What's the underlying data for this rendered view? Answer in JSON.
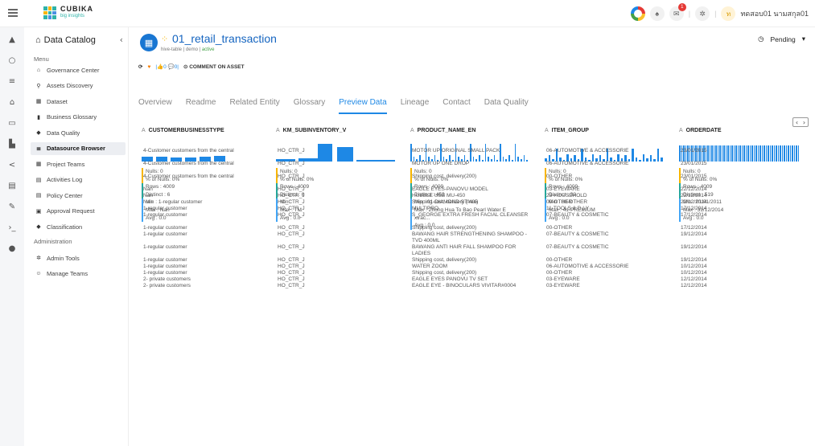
{
  "topbar": {
    "brand": "CUBIKA",
    "brand_sub": "big insights",
    "username": "ทดสอบ01 นามสกุล01",
    "avatar_letter": "ท",
    "notification_count": "1"
  },
  "menu": {
    "title": "Data Catalog",
    "section_menu": "Menu",
    "section_admin": "Administration",
    "items": [
      {
        "label": "Governance Center",
        "icon": "bank-icon"
      },
      {
        "label": "Assets Discovery",
        "icon": "search-icon"
      },
      {
        "label": "Dataset",
        "icon": "table-icon"
      },
      {
        "label": "Business Glossary",
        "icon": "book-icon"
      },
      {
        "label": "Data Quality",
        "icon": "shield-icon"
      },
      {
        "label": "Datasource Browser",
        "icon": "database-icon"
      },
      {
        "label": "Project Teams",
        "icon": "grid-icon"
      },
      {
        "label": "Activities Log",
        "icon": "log-icon"
      },
      {
        "label": "Policy Center",
        "icon": "policy-icon"
      },
      {
        "label": "Approval Request",
        "icon": "approval-icon"
      },
      {
        "label": "Classification",
        "icon": "tag-icon"
      }
    ],
    "admin_items": [
      {
        "label": "Admin Tools",
        "icon": "gear-icon"
      },
      {
        "label": "Manage Teams",
        "icon": "people-icon"
      }
    ]
  },
  "asset": {
    "title": "01_retail_transaction",
    "type": "hive-table",
    "project": "demo",
    "state": "active",
    "likes": "0",
    "comments": "0",
    "comment_action": "COMMENT ON ASSET",
    "status": "Pending"
  },
  "tabs": [
    "Overview",
    "Readme",
    "Related Entity",
    "Glossary",
    "Preview Data",
    "Lineage",
    "Contact",
    "Data Quality"
  ],
  "columns": [
    {
      "name": "CUSTOMERBUSINESSTYPE",
      "type": "A",
      "stats": [
        "Nulls: 0",
        "% of Nulls: 0%",
        "Rows : 4009",
        "Distinct : 6",
        "Min : 1-regular customer",
        "Max : Nan",
        "Avg : 0.0"
      ]
    },
    {
      "name": "KM_SUBINVENTORY_V",
      "type": "A",
      "stats": [
        "Nulls: 0",
        "% of Nulls: 0%",
        "Rows : 4009",
        "Distinct : 6",
        "Min :",
        "Max : TM",
        "Avg : 0.0"
      ]
    },
    {
      "name": "PRODUCT_NAME_EN",
      "type": "A",
      "stats": [
        "Nulls: 0",
        "% of Nulls: 0%",
        "Rows : 4009",
        "Distinct : 452",
        "Min : 01-DIAMOND ST-405",
        "Max : Zhong Hua To Bao Pearl Water E",
        "xtrac...",
        "Avg : 0.0"
      ]
    },
    {
      "name": "ITEM_GROUP",
      "type": "A",
      "stats": [
        "Nulls: 0",
        "% of Nulls: 0%",
        "Rows : 4009",
        "Distinct : 33",
        "Min : 00-OTHER",
        "Max : 41-PREMIUM",
        "Avg : 0.0"
      ]
    },
    {
      "name": "ORDERDATE",
      "type": "A",
      "stats": [
        "Nulls: 0",
        "% of Nulls: 0%",
        "Rows : 4009",
        "Distinct : 519",
        "Min : 01/01/2011",
        "Max : 31/12/2014",
        "Avg : 0.0"
      ]
    }
  ],
  "rows": [
    [
      "4-Customer customers from the central",
      "HO_CTR_J",
      "MOTOR UP ORIGINAL SMALL PACK",
      "06-AUTOMOTIVE & ACCESSORIE",
      "23/01/2015"
    ],
    [
      "4-Customer customers from the central",
      "HO_CTR_J",
      "MOTOR UP ONE DROP",
      "06-AUTOMOTIVE & ACCESSORIE",
      "23/01/2015"
    ],
    [
      "4-Customer customers from the central",
      "HO_CTR_J",
      "Shipping cost, delivery(200)",
      "00-OTHER",
      "23/01/2015"
    ],
    [
      "Nan",
      "HO_CTR_J",
      "EAGLE EYES-PANOVU MODEL",
      "03-EYEWARE",
      "22/12/2014"
    ],
    [
      "Nan",
      "HO_CTR_J",
      "HUBBLE USB MU-450",
      "23-HOUSEHOLD",
      "22/12/2014"
    ],
    [
      "Nan",
      "HO_CTR_J",
      "Shipping cost, delivery (free)",
      "00-OTHER",
      "22/12/2014"
    ],
    [
      "1-regular customer",
      "HO_CTR_J",
      "MULTIPRO",
      "11-TOOLS & D.I.Y",
      "17/12/2014"
    ],
    [
      "1-regular customer",
      "HO_CTR_J",
      "S_GEORGE EXTRA FRESH FACIAL CLEANSER",
      "07-BEAUTY & COSMETIC",
      "17/12/2014"
    ],
    [
      "1-regular customer",
      "HO_CTR_J",
      "Shipping cost, delivery(200)",
      "00-OTHER",
      "17/12/2014"
    ],
    [
      "1-regular customer",
      "HO_CTR_J",
      "BAWANG HAIR STRENGTHENING SHAMPOO - TVD 400ML",
      "07-BEAUTY & COSMETIC",
      "19/12/2014"
    ],
    [
      "1-regular customer",
      "HO_CTR_J",
      "BAWANG ANTI HAIR FALL SHAMPOO FOR LADIES",
      "07-BEAUTY & COSMETIC",
      "19/12/2014"
    ],
    [
      "1-regular customer",
      "HO_CTR_J",
      "Shipping cost, delivery(200)",
      "00-OTHER",
      "19/12/2014"
    ],
    [
      "1-regular customer",
      "HO_CTR_J",
      "WATER ZOOM",
      "06-AUTOMOTIVE & ACCESSORIE",
      "10/12/2014"
    ],
    [
      "1-regular customer",
      "HO_CTR_J",
      "Shipping cost, delivery(200)",
      "00-OTHER",
      "10/12/2014"
    ],
    [
      "2- private customers",
      "HO_CTR_J",
      "EAGLE EYES PANOVU TV SET",
      "03-EYEWARE",
      "12/12/2014"
    ],
    [
      "2- private customers",
      "HO_CTR_J",
      "EAGLE EYE - BINOCULARS VIVITAR#0004",
      "03-EYEWARE",
      "12/12/2014"
    ]
  ]
}
